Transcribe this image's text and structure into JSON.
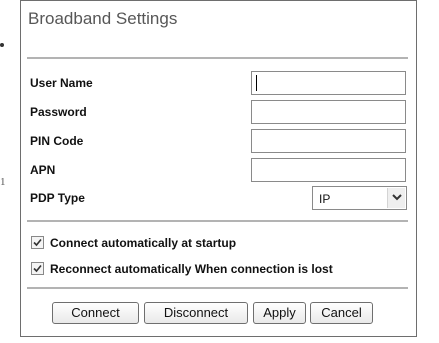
{
  "panel": {
    "title": "Broadband Settings"
  },
  "form": {
    "username": {
      "label": "User Name",
      "value": ""
    },
    "password": {
      "label": "Password",
      "value": ""
    },
    "pin_code": {
      "label": "PIN Code",
      "value": ""
    },
    "apn": {
      "label": "APN",
      "value": ""
    },
    "pdp_type": {
      "label": "PDP Type",
      "selected": "IP"
    }
  },
  "options": {
    "auto_connect": {
      "label": "Connect automatically at startup",
      "checked": true
    },
    "auto_reconnect": {
      "label": "Reconnect automatically When connection is lost",
      "checked": true
    }
  },
  "buttons": {
    "connect": "Connect",
    "disconnect": "Disconnect",
    "apply": "Apply",
    "cancel": "Cancel"
  },
  "edge_marks": {
    "lower": "1"
  },
  "icons": {
    "select_arrow": "chevron-down-icon",
    "checkbox_mark": "checkmark-icon"
  }
}
